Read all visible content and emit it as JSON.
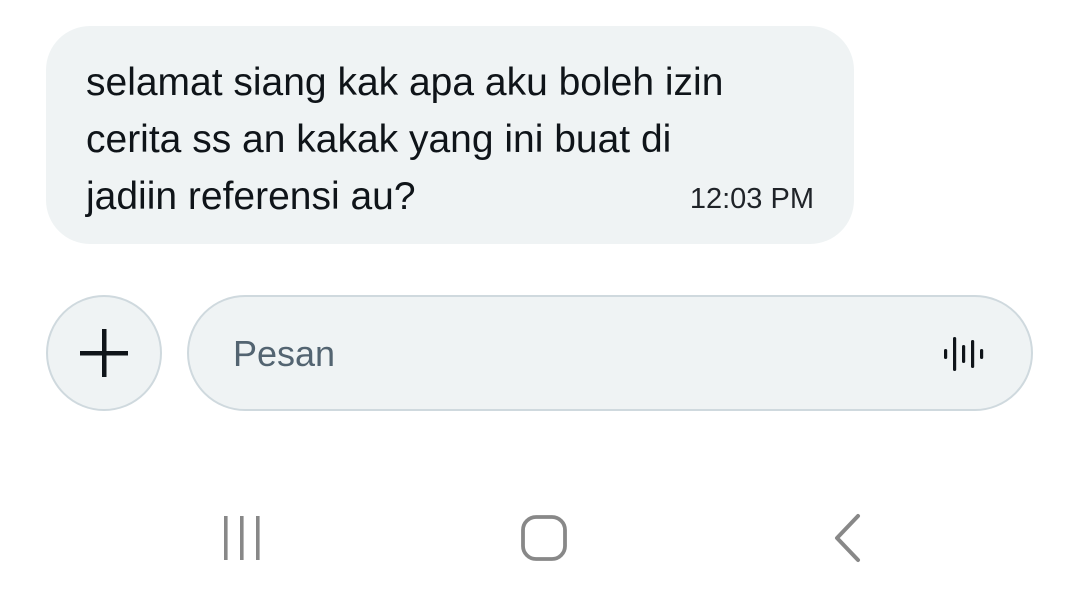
{
  "message": {
    "text": "selamat siang kak apa aku boleh izin\ncerita ss an kakak yang ini buat di\njadiin referensi au?",
    "time": "12:03 PM"
  },
  "composer": {
    "placeholder": "Pesan",
    "value": "",
    "add_icon": "plus-icon",
    "voice_icon": "voice-waveform-icon"
  },
  "navbar": {
    "recent_icon": "recent-apps-icon",
    "home_icon": "home-icon",
    "back_icon": "back-icon"
  },
  "colors": {
    "bubble_bg": "#eff3f4",
    "border": "#cfd9de",
    "text": "#0f1419",
    "placeholder": "#536471",
    "nav_icon": "#888888"
  }
}
